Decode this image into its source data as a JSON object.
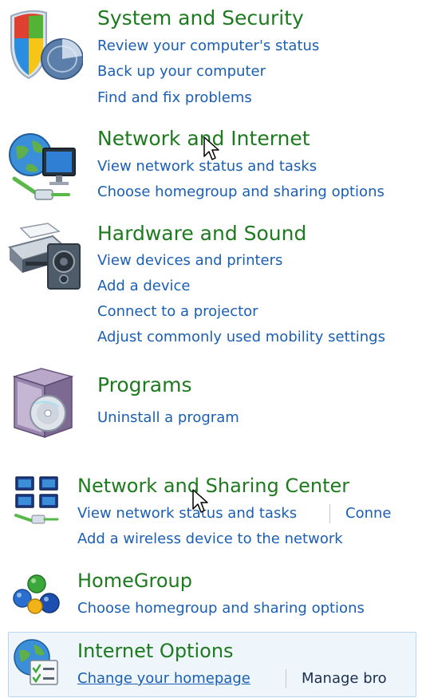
{
  "categories": [
    {
      "title": "System and Security",
      "icon": "shield-icon",
      "links": [
        "Review your computer's status",
        "Back up your computer",
        "Find and fix problems"
      ]
    },
    {
      "title": "Network and Internet",
      "icon": "network-globe-icon",
      "links": [
        "View network status and tasks",
        "Choose homegroup and sharing options"
      ]
    },
    {
      "title": "Hardware and Sound",
      "icon": "printer-speaker-icon",
      "links": [
        "View devices and printers",
        "Add a device",
        "Connect to a projector",
        "Adjust commonly used mobility settings"
      ]
    },
    {
      "title": "Programs",
      "icon": "programs-box-icon",
      "links": [
        "Uninstall a program"
      ]
    }
  ],
  "subitems": [
    {
      "title": "Network and Sharing Center",
      "icon": "network-sharing-icon",
      "links": [
        "View network status and tasks",
        "Conne",
        "Add a wireless device to the network"
      ]
    },
    {
      "title": "HomeGroup",
      "icon": "homegroup-icon",
      "links": [
        "Choose homegroup and sharing options"
      ]
    },
    {
      "title": "Internet Options",
      "icon": "internet-options-icon",
      "links": [
        "Change your homepage",
        "Manage bro"
      ]
    }
  ],
  "colors": {
    "title_green": "#1e7a1e",
    "link_blue": "#1a5fb4",
    "highlight_bg": "#eef6fc",
    "highlight_border": "#b8d6ee"
  }
}
